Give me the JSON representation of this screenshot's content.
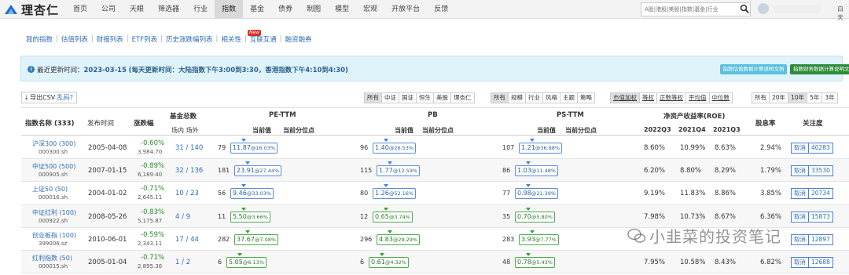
{
  "brand": {
    "name": "理杏仁"
  },
  "nav": [
    "首页",
    "公司",
    "天眼",
    "筛选器",
    "行业",
    "指数",
    "基金",
    "债券",
    "制图",
    "模型",
    "宏观",
    "开放平台",
    "反馈"
  ],
  "search": {
    "placeholder": "A股|港股|美股|指数|基金|行业"
  },
  "user": {
    "tail": "白天"
  },
  "subnav": [
    "我的指数",
    "估值列表",
    "财报列表",
    "ETF列表",
    "历史涨跌幅列表",
    "相关性",
    "互联互通",
    "融资融券"
  ],
  "new_badge": "New",
  "info": {
    "label": "最近更新时间：",
    "date": "2023-03-15",
    "note": "(每天更新时间：大陆指数下午3:00到3:30，香港指数下午4:10到4:30)",
    "btn1": "指数估值数据计算说明文档",
    "btn2": "指数财务数据计算说明文档"
  },
  "export": {
    "label": "导出CSV",
    "link": "乱码?"
  },
  "filters": {
    "markets": [
      "所有",
      "中证",
      "国证",
      "恒生",
      "美股",
      "理杏仁"
    ],
    "types": [
      "所有",
      "规模",
      "行业",
      "风格",
      "主题",
      "策略"
    ],
    "weights": [
      "市值加权",
      "等权",
      "正数等权",
      "平均值",
      "中位数"
    ],
    "periods": [
      "所有",
      "20年",
      "10年",
      "5年",
      "3年"
    ]
  },
  "headers": {
    "name": "指数名称 (333)",
    "date": "发布时间",
    "chg": "涨跌幅",
    "fund": "基金总数",
    "fund_sub": "场内 场外",
    "pe": "PE-TTM",
    "pb": "PB",
    "ps": "PS-TTM",
    "sub_val": "当前值",
    "sub_pct": "当前分位点",
    "roe": "净资产收益率(ROE)",
    "roe_cols": [
      "2022Q3",
      "2021Q4",
      "2021Q3"
    ],
    "div": "股息率",
    "follow": "关注度"
  },
  "rows": [
    {
      "name": "沪深300 (300)",
      "code": "000300.sh",
      "date": "2005-04-08",
      "chg": "-0.60%",
      "close": "3,984.70",
      "fund": "31 / 140",
      "pe_n": "79",
      "pe": "11.87",
      "pe_p": "@16.03%",
      "pb_n": "96",
      "pb": "1.40",
      "pb_p": "@26.53%",
      "ps_n": "107",
      "ps": "1.21",
      "ps_p": "@36.98%",
      "roe": [
        "8.60%",
        "10.99%",
        "8.63%"
      ],
      "div": "2.94%",
      "cancel": "取消",
      "follow": "40283",
      "g": false
    },
    {
      "name": "中证500 (500)",
      "code": "000905.sh",
      "date": "2007-01-15",
      "chg": "-0.89%",
      "close": "6,189.40",
      "fund": "32 / 136",
      "pe_n": "181",
      "pe": "23.91",
      "pe_p": "@27.44%",
      "pb_n": "115",
      "pb": "1.77",
      "pb_p": "@12.59%",
      "ps_n": "86",
      "ps": "1.03",
      "ps_p": "@11.48%",
      "roe": [
        "6.20%",
        "8.80%",
        "8.29%"
      ],
      "div": "1.79%",
      "cancel": "取消",
      "follow": "33530",
      "g": false
    },
    {
      "name": "上证50 (50)",
      "code": "000016.sh",
      "date": "2004-01-02",
      "chg": "-0.71%",
      "close": "2,645.11",
      "fund": "10 / 23",
      "pe_n": "56",
      "pe": "9.46",
      "pe_p": "@33.03%",
      "pb_n": "80",
      "pb": "1.26",
      "pb_p": "@52.16%",
      "ps_n": "77",
      "ps": "0.98",
      "ps_p": "@21.39%",
      "roe": [
        "9.19%",
        "11.83%",
        "8.86%"
      ],
      "div": "3.85%",
      "cancel": "取消",
      "follow": "20734",
      "g": false
    },
    {
      "name": "中证红利 (100)",
      "code": "000922.sh",
      "date": "2008-05-26",
      "chg": "-0.83%",
      "close": "5,175.87",
      "fund": "4 / 9",
      "pe_n": "11",
      "pe": "5.50",
      "pe_p": "@3.66%",
      "pb_n": "12",
      "pb": "0.65",
      "pb_p": "@3.74%",
      "ps_n": "35",
      "ps": "0.70",
      "ps_p": "@5.80%",
      "roe": [
        "7.98%",
        "10.73%",
        "8.67%"
      ],
      "div": "6.36%",
      "cancel": "取消",
      "follow": "15873",
      "g": true
    },
    {
      "name": "创业板指 (100)",
      "code": "399006.sz",
      "date": "2010-06-01",
      "chg": "-0.59%",
      "close": "2,343.11",
      "fund": "17 / 44",
      "pe_n": "282",
      "pe": "37.67",
      "pe_p": "@7.08%",
      "pb_n": "296",
      "pb": "4.83",
      "pb_p": "@29.29%",
      "ps_n": "283",
      "ps": "3.93",
      "ps_p": "@7.77%",
      "roe": [
        "",
        "",
        "",
        "",
        ""
      ],
      "div": "",
      "cancel": "取消",
      "follow": "12897",
      "g": true
    },
    {
      "name": "红利指数 (50)",
      "code": "000015.sh",
      "date": "2005-01-04",
      "chg": "-0.71%",
      "close": "2,895.36",
      "fund": "1 / 2",
      "pe_n": "6",
      "pe": "5.05",
      "pe_p": "@6.13%",
      "pb_n": "6",
      "pb": "0.61",
      "pb_p": "@4.32%",
      "ps_n": "48",
      "ps": "0.78",
      "ps_p": "@5.43%",
      "roe": [
        "7.95%",
        "10.58%",
        "8.43%"
      ],
      "div": "6.82%",
      "cancel": "取消",
      "follow": "12688",
      "g": true
    }
  ],
  "watermark": "小韭菜的投资笔记"
}
